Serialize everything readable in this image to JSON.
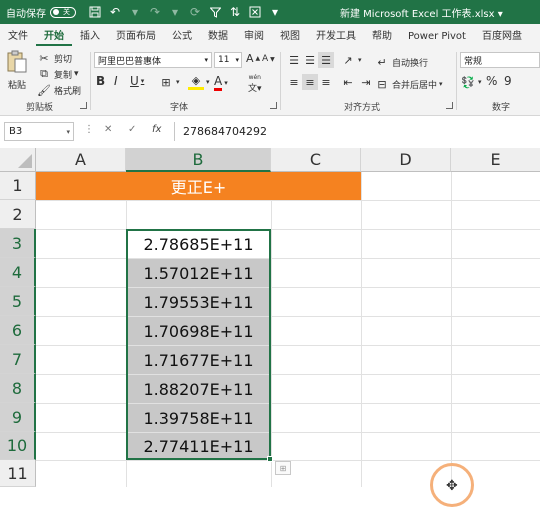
{
  "titlebar": {
    "autosave_label": "自动保存",
    "autosave_state": "关",
    "title": "新建 Microsoft Excel 工作表.xlsx",
    "title_chevron": "▾"
  },
  "tabs": [
    "文件",
    "开始",
    "插入",
    "页面布局",
    "公式",
    "数据",
    "审阅",
    "视图",
    "开发工具",
    "帮助",
    "Power Pivot",
    "百度网盘"
  ],
  "ribbon": {
    "clipboard": {
      "paste": "粘贴",
      "cut": "剪切",
      "copy": "复制",
      "format_painter": "格式刷",
      "label": "剪贴板"
    },
    "font": {
      "name": "阿里巴巴普惠体",
      "size": "11",
      "grow": "A",
      "shrink": "A",
      "bold": "B",
      "italic": "I",
      "underline": "U",
      "font_color": "A",
      "wen": "wén",
      "label": "字体"
    },
    "alignment": {
      "wrap": "自动换行",
      "merge": "合并后居中",
      "label": "对齐方式"
    },
    "number": {
      "format": "常规",
      "percent": "%",
      "comma": "9",
      "label": "数字"
    }
  },
  "formula_bar": {
    "name_box": "B3",
    "cancel": "✕",
    "enter": "✓",
    "fx": "fx",
    "value": "278684704292"
  },
  "sheet": {
    "columns": [
      "A",
      "B",
      "C",
      "D",
      "E"
    ],
    "rows": [
      "1",
      "2",
      "3",
      "4",
      "5",
      "6",
      "7",
      "8",
      "9",
      "10",
      "11"
    ],
    "banner_text": "更正E+",
    "b_values": [
      "2.78685E+11",
      "1.57012E+11",
      "1.79553E+11",
      "1.70698E+11",
      "1.71677E+11",
      "1.88207E+11",
      "1.39758E+11",
      "2.77411E+11"
    ]
  },
  "colors": {
    "excel_green": "#217346",
    "banner_orange": "#F58220",
    "selection_gray": "#C8C8C8"
  }
}
